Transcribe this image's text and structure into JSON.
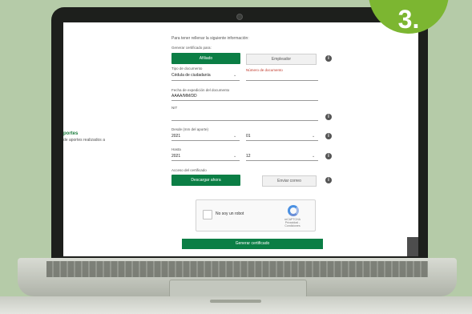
{
  "step_badge": "3.",
  "side": {
    "title": "portes",
    "subtitle": "de aportes realizados a"
  },
  "form": {
    "intro": "Para tener rellenar la siguiente información:",
    "generate_label": "Generar certificado para:",
    "btn_option1": "Afiliado",
    "btn_option2": "Empleador",
    "doc_type_label": "Tipo de documento",
    "doc_type_value": "Cédula de ciudadanía",
    "doc_number_label": "Número de documento",
    "exp_date_label": "Fecha de expedición del documento",
    "exp_date_value": "AAAA/MM/DD",
    "nit_label": "NIT",
    "from_label": "Desde (mm del aporte)",
    "from_year": "2021",
    "from_month": "01",
    "to_label": "Hasta",
    "to_year": "2021",
    "to_month": "12",
    "access_label": "Acceso del certificado",
    "btn_access1": "Descargar ahora",
    "btn_access2": "Enviar correo",
    "captcha_text": "No soy un robot",
    "captcha_brand": "reCAPTCHA",
    "captcha_terms": "Privacidad - Condiciones",
    "submit_label": "Generar certificado"
  }
}
